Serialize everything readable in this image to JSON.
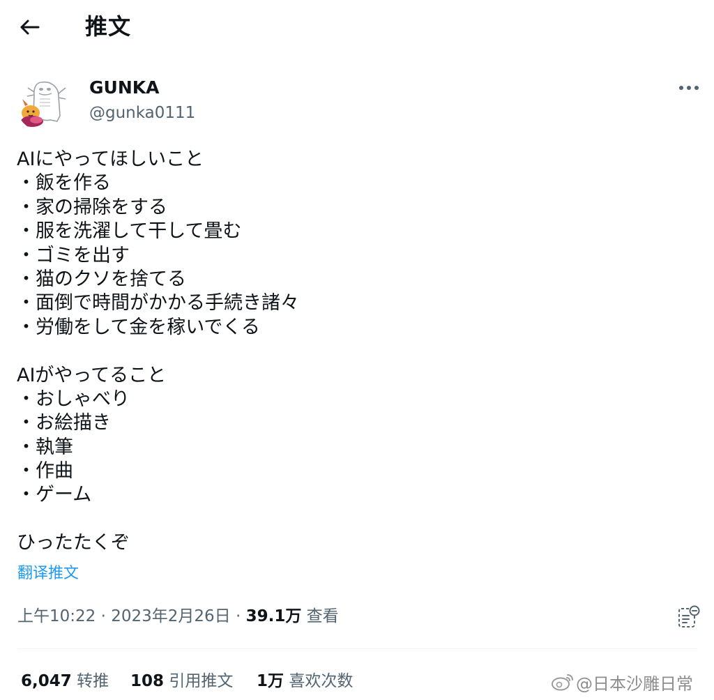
{
  "header": {
    "title": "推文",
    "back_icon": "arrow-left-icon"
  },
  "author": {
    "display_name": "GUNKA",
    "handle": "@gunka0111",
    "avatar_icon": "avatar-illustration"
  },
  "more_icon": "more-horizontal-icon",
  "tweet": {
    "lines": [
      "AIにやってほしいこと",
      "・飯を作る",
      "・家の掃除をする",
      "・服を洗濯して干して畳む",
      "・ゴミを出す",
      "・猫のクソを捨てる",
      "・面倒で時間がかかる手続き諸々",
      "・労働をして金を稼いでくる",
      "",
      "AIがやってること",
      "・おしゃべり",
      "・お絵描き",
      "・執筆",
      "・作曲",
      "・ゲーム",
      "",
      "ひったたくぞ"
    ],
    "translate_label": "翻译推文"
  },
  "meta": {
    "time": "上午10:22",
    "separator": " · ",
    "date": "2023年2月26日",
    "views_count": "39.1万",
    "views_label": "查看",
    "analytics_icon": "analytics-icon"
  },
  "stats": {
    "retweets": {
      "count": "6,047",
      "label": "转推"
    },
    "quotes": {
      "count": "108",
      "label": "引用推文"
    },
    "likes": {
      "count": "1万",
      "label": "喜欢次数"
    }
  },
  "watermark": {
    "text": "@日本沙雕日常",
    "icon": "weibo-icon"
  },
  "colors": {
    "text": "#0f1419",
    "secondary": "#536471",
    "link": "#1d9bf0",
    "divider": "#eff3f4"
  }
}
